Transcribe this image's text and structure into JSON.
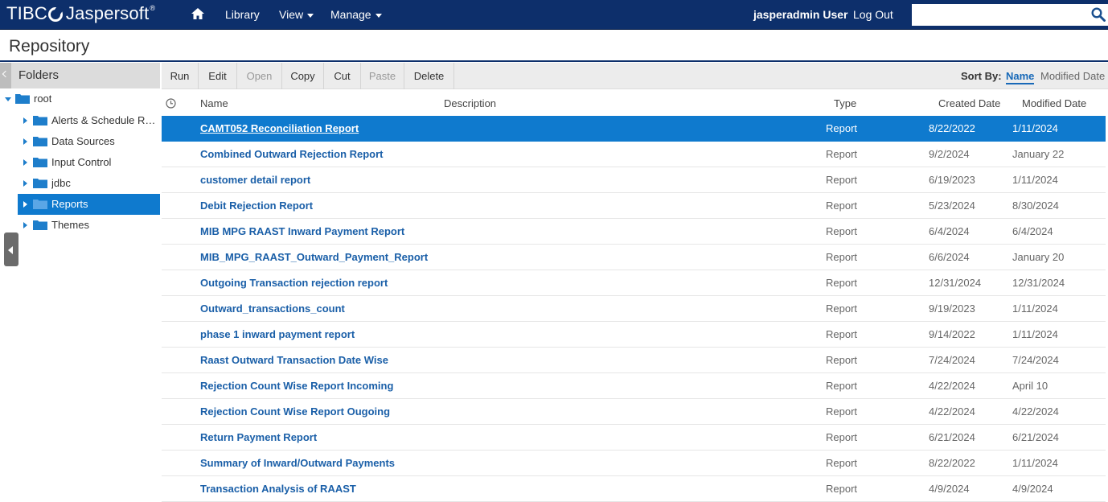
{
  "brand": {
    "logo_text_left": "TIBC",
    "logo_text_right": "Jaspersoft",
    "trademark": "®"
  },
  "nav": {
    "home_icon": "home-icon",
    "library": "Library",
    "view": "View",
    "manage": "Manage",
    "user": "jasperadmin User",
    "logout": "Log Out",
    "search_placeholder": "",
    "search_icon": "search-icon"
  },
  "page": {
    "title": "Repository"
  },
  "folders": {
    "header": "Folders",
    "items": [
      {
        "label": "root",
        "expanded": true,
        "level": 0
      },
      {
        "label": "Alerts & Schedule Rep...",
        "level": 1
      },
      {
        "label": "Data Sources",
        "level": 1
      },
      {
        "label": "Input Control",
        "level": 1
      },
      {
        "label": "jdbc",
        "level": 1
      },
      {
        "label": "Reports",
        "level": 1,
        "selected": true
      },
      {
        "label": "Themes",
        "level": 1
      }
    ]
  },
  "toolbar": {
    "buttons": [
      {
        "label": "Run",
        "enabled": true
      },
      {
        "label": "Edit",
        "enabled": true
      },
      {
        "label": "Open",
        "enabled": false
      },
      {
        "label": "Copy",
        "enabled": true
      },
      {
        "label": "Cut",
        "enabled": true
      },
      {
        "label": "Paste",
        "enabled": false
      },
      {
        "label": "Delete",
        "enabled": true
      }
    ],
    "sort_by_label": "Sort By:",
    "sort_name": "Name",
    "sort_modified": "Modified Date"
  },
  "columns": {
    "name": "Name",
    "description": "Description",
    "type": "Type",
    "created": "Created Date",
    "modified": "Modified Date"
  },
  "colors": {
    "topbar": "#0d2f6b",
    "accent": "#0f7ace",
    "link": "#1a5fa8"
  },
  "resources": [
    {
      "name": "CAMT052 Reconciliation Report",
      "type": "Report",
      "created": "8/22/2022",
      "modified": "1/11/2024",
      "selected": true
    },
    {
      "name": "Combined Outward Rejection Report",
      "type": "Report",
      "created": "9/2/2024",
      "modified": "January 22"
    },
    {
      "name": "customer detail report",
      "type": "Report",
      "created": "6/19/2023",
      "modified": "1/11/2024"
    },
    {
      "name": "Debit Rejection Report",
      "type": "Report",
      "created": "5/23/2024",
      "modified": "8/30/2024"
    },
    {
      "name": "MIB MPG RAAST Inward Payment Report",
      "type": "Report",
      "created": "6/4/2024",
      "modified": "6/4/2024"
    },
    {
      "name": "MIB_MPG_RAAST_Outward_Payment_Report",
      "type": "Report",
      "created": "6/6/2024",
      "modified": "January 20"
    },
    {
      "name": "Outgoing Transaction rejection report",
      "type": "Report",
      "created": "12/31/2024",
      "modified": "12/31/2024"
    },
    {
      "name": "Outward_transactions_count",
      "type": "Report",
      "created": "9/19/2023",
      "modified": "1/11/2024"
    },
    {
      "name": "phase 1 inward payment report",
      "type": "Report",
      "created": "9/14/2022",
      "modified": "1/11/2024"
    },
    {
      "name": "Raast Outward Transaction Date Wise",
      "type": "Report",
      "created": "7/24/2024",
      "modified": "7/24/2024"
    },
    {
      "name": "Rejection Count Wise Report Incoming",
      "type": "Report",
      "created": "4/22/2024",
      "modified": "April 10"
    },
    {
      "name": "Rejection Count Wise Report Ougoing",
      "type": "Report",
      "created": "4/22/2024",
      "modified": "4/22/2024"
    },
    {
      "name": "Return Payment Report",
      "type": "Report",
      "created": "6/21/2024",
      "modified": "6/21/2024"
    },
    {
      "name": "Summary of Inward/Outward Payments",
      "type": "Report",
      "created": "8/22/2022",
      "modified": "1/11/2024"
    },
    {
      "name": "Transaction Analysis of RAAST",
      "type": "Report",
      "created": "4/9/2024",
      "modified": "4/9/2024"
    }
  ]
}
